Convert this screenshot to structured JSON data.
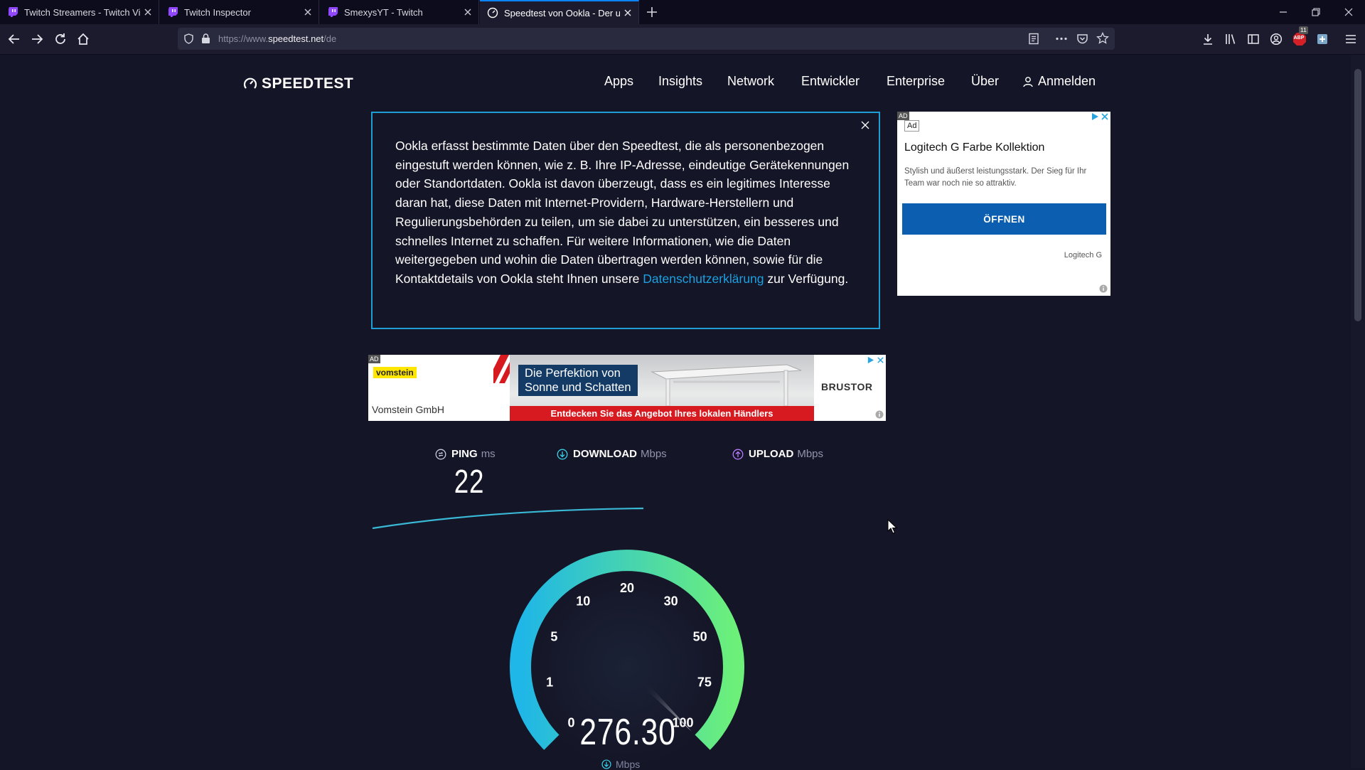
{
  "browser": {
    "tabs": [
      {
        "title": "Twitch Streamers - Twitch Vide",
        "active": false
      },
      {
        "title": "Twitch Inspector",
        "active": false
      },
      {
        "title": "SmexysYT - Twitch",
        "active": false
      },
      {
        "title": "Speedtest von Ookla - Der umf",
        "active": true
      }
    ],
    "url_prefix": "https://www.",
    "url_host": "speedtest.net",
    "url_path": "/de",
    "badge_count": "11",
    "abp_label": "ABP"
  },
  "site": {
    "logo": "SPEEDTEST",
    "nav": [
      "Apps",
      "Insights",
      "Network",
      "Entwickler",
      "Enterprise",
      "Über",
      "Anmelden"
    ]
  },
  "consent": {
    "text": "Ookla erfasst bestimmte Daten über den Speedtest, die als personenbezogen eingestuft werden können, wie z. B. Ihre IP-Adresse, eindeutige Gerätekennungen oder Standortdaten. Ookla ist davon überzeugt, dass es ein legitimes Interesse daran hat, diese Daten mit Internet-Providern, Hardware-Herstellern und Regulierungsbehörden zu teilen, um sie dabei zu unterstützen, ein besseres und schnelles Internet zu schaffen. Für weitere Informationen, wie die Daten weitergegeben und wohin die Daten übertragen werden können, sowie für die Kontaktdetails von Ookla steht Ihnen unsere ",
    "link": "Datenschutzerklärung",
    "suffix": " zur Verfügung."
  },
  "side_ad": {
    "tag": "AD",
    "ad_label": "Ad",
    "title": "Logitech G Farbe Kollektion",
    "description": "Stylish und äußerst leistungsstark. Der Sieg für Ihr Team war noch nie so attraktiv.",
    "button": "ÖFFNEN",
    "brand": "Logitech G"
  },
  "banner_ad": {
    "tag": "AD",
    "logo": "vomstein",
    "company": "Vomstein GmbH",
    "headline_1": "Die Perfektion von",
    "headline_2": "Sonne und Schatten",
    "footer": "Entdecken Sie das Angebot Ihres lokalen Händlers",
    "brand": "BRUSTOR"
  },
  "metrics": {
    "ping_label": "PING",
    "ping_unit": "ms",
    "ping_value": "22",
    "download_label": "DOWNLOAD",
    "download_unit": "Mbps",
    "upload_label": "UPLOAD",
    "upload_unit": "Mbps"
  },
  "gauge": {
    "ticks": [
      "0",
      "1",
      "5",
      "10",
      "20",
      "30",
      "50",
      "75",
      "100"
    ],
    "value": "276.30",
    "unit": "Mbps",
    "needle_level": 1.0
  },
  "colors": {
    "background": "#141526",
    "accent_blue": "#1f9ed6",
    "gauge_start": "#1fb6e8",
    "gauge_end": "#6cf07a",
    "ad_button": "#0b5eb0"
  },
  "icons": {
    "logo": "speedometer-icon",
    "ping": "ping-icon",
    "download": "download-arrow-icon",
    "upload": "upload-arrow-icon"
  }
}
